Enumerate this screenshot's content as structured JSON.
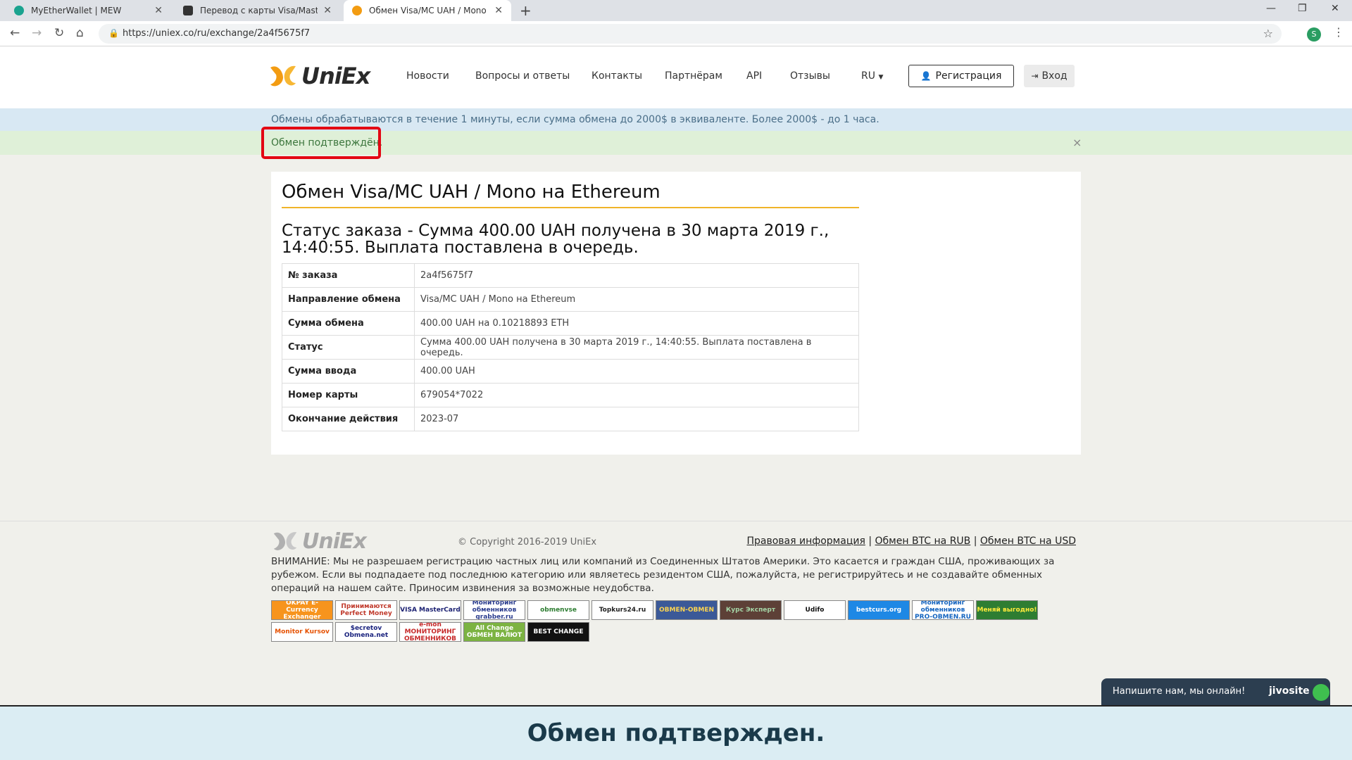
{
  "browser": {
    "tabs": [
      {
        "title": "MyEtherWallet | MEW",
        "favicon_color": "#1aa38f"
      },
      {
        "title": "Перевод с карты Visa/MasterCard",
        "favicon_color": "#333333"
      },
      {
        "title": "Обмен Visa/MC UAH / Mono на",
        "favicon_color": "#f39c12"
      }
    ],
    "url": "https://uniex.co/ru/exchange/2a4f5675f7",
    "profile_initial": "S"
  },
  "header": {
    "logo_text": "UniEx",
    "nav": [
      "Новости",
      "Вопросы и ответы",
      "Контакты",
      "Партнёрам",
      "API",
      "Отзывы",
      "RU"
    ],
    "register_label": "Регистрация",
    "login_label": "Вход"
  },
  "info_bar": "Обмены обрабатываются в течение 1 минуты, если сумма обмена до 2000$ в эквиваленте. Более 2000$ - до 1 часа.",
  "success_bar": {
    "message": "Обмен подтверждён.",
    "close": "×"
  },
  "order": {
    "title": "Обмен Visa/MC UAH / Mono на Ethereum",
    "status_heading": "Статус заказа - Сумма 400.00 UAH получена в 30 марта 2019 г., 14:40:55. Выплата поставлена в очередь.",
    "rows": [
      {
        "label": "№ заказа",
        "value": "2a4f5675f7"
      },
      {
        "label": "Направление обмена",
        "value": "Visa/MC UAH / Mono на Ethereum"
      },
      {
        "label": "Сумма обмена",
        "value": "400.00 UAH на 0.10218893 ETH"
      },
      {
        "label": "Статус",
        "value": "Сумма 400.00 UAH получена в 30 марта 2019 г., 14:40:55. Выплата поставлена в очередь."
      },
      {
        "label": "Сумма ввода",
        "value": "400.00 UAH"
      },
      {
        "label": "Номер карты",
        "value": "679054*7022"
      },
      {
        "label": "Окончание действия",
        "value": "2023-07"
      }
    ]
  },
  "footer": {
    "logo_text": "UniEx",
    "copyright": "© Copyright 2016-2019 UniEx",
    "links": [
      "Правовая информация",
      "Обмен BTC на RUB",
      "Обмен BTC на USD"
    ],
    "warning": "ВНИМАНИЕ: Мы не разрешаем регистрацию частных лиц или компаний из Соединенных Штатов Америки. Это касается и граждан США, проживающих за рубежом. Если вы подпадаете под последнюю категорию или являетесь резидентом США, пожалуйста, не регистрируйтесь и не создавайте обменных операций на нашем сайте. Приносим извинения за возможные неудобства.",
    "badges": [
      {
        "text": "OKPAY E-Currency Exchanger",
        "bg": "#f7941d",
        "fg": "#ffffff"
      },
      {
        "text": "Принимаются Perfect Money",
        "bg": "#ffffff",
        "fg": "#c0392b"
      },
      {
        "text": "VISA MasterCard",
        "bg": "#ffffff",
        "fg": "#1a1f71"
      },
      {
        "text": "Мониторинг обменников grabber.ru",
        "bg": "#ffffff",
        "fg": "#2c3e8f"
      },
      {
        "text": "obmenvse",
        "bg": "#ffffff",
        "fg": "#2e7d32"
      },
      {
        "text": "Topkurs24.ru",
        "bg": "#ffffff",
        "fg": "#222222"
      },
      {
        "text": "OBMEN-OBMEN",
        "bg": "#3b5998",
        "fg": "#ffd54f"
      },
      {
        "text": "Курс Эксперт",
        "bg": "#5d4037",
        "fg": "#a5d6a7"
      },
      {
        "text": "Udifo",
        "bg": "#ffffff",
        "fg": "#111111"
      },
      {
        "text": "bestcurs.org",
        "bg": "#1e88e5",
        "fg": "#ffffff"
      },
      {
        "text": "Мониторинг обменников PRO-OBMEN.RU",
        "bg": "#ffffff",
        "fg": "#1565c0"
      },
      {
        "text": "Меняй выгодно!",
        "bg": "#2e7d32",
        "fg": "#ffeb3b"
      },
      {
        "text": "Monitor Kursov",
        "bg": "#ffffff",
        "fg": "#e65100"
      },
      {
        "text": "$ecretov Obmena.net",
        "bg": "#ffffff",
        "fg": "#1a237e"
      },
      {
        "text": "e-mon МОНИТОРИНГ ОБМЕННИКОВ",
        "bg": "#ffffff",
        "fg": "#c62828"
      },
      {
        "text": "All Change ОБМЕН ВАЛЮТ",
        "bg": "#7cb342",
        "fg": "#ffffff"
      },
      {
        "text": "BEST CHANGE",
        "bg": "#111111",
        "fg": "#ffffff"
      }
    ]
  },
  "chat": {
    "text": "Напишите нам, мы онлайн!",
    "brand": "jivosite"
  },
  "caption": "Обмен подтвержден.",
  "colors": {
    "accent": "#f0b429",
    "highlight": "#e30613",
    "success_bg": "#dff0d8",
    "info_bg": "#d8e8f3"
  }
}
